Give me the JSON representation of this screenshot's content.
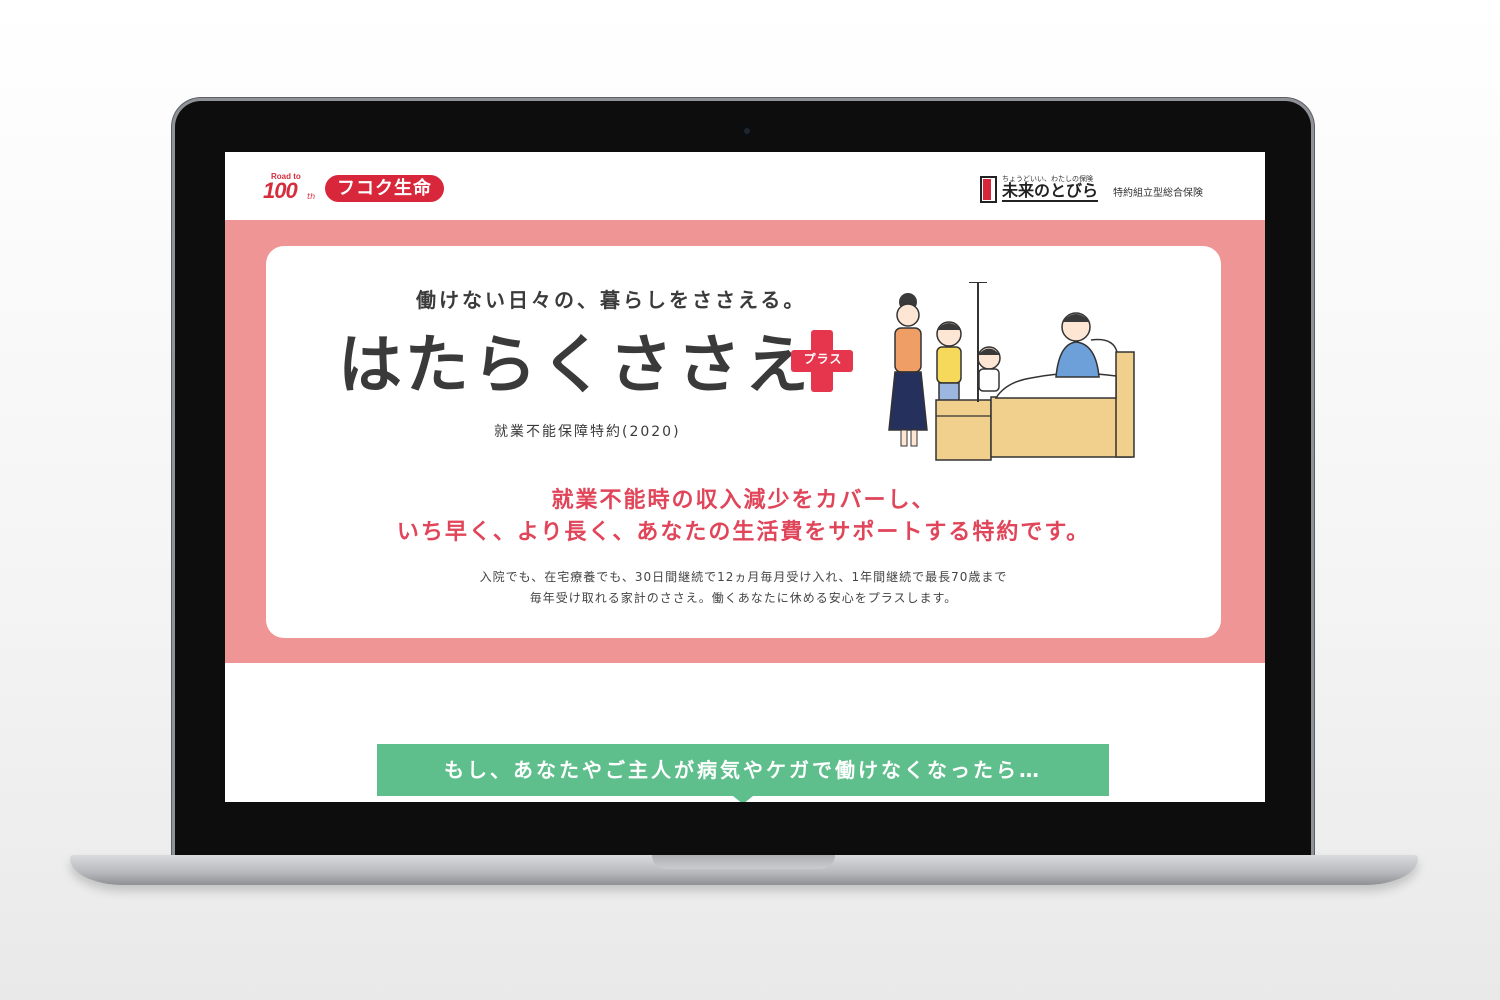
{
  "header": {
    "road_small": "Road to",
    "road_big": "100",
    "road_suffix": "th",
    "company": "フコク生命",
    "mirai_tagline": "ちょうどいい、わたしの保険",
    "mirai_name": "未来のとびら",
    "mirai_sub": "特約組立型総合保険"
  },
  "hero": {
    "tagline": "働けない日々の、暮らしをささえる。",
    "brand": "はたらくささえ",
    "plus_label": "プラス",
    "product_subtitle": "就業不能保障特約(2020)",
    "catch_line1": "就業不能時の収入減少をカバーし、",
    "catch_line2": "いち早く、より長く、あなたの生活費をサポートする特約です。",
    "desc_line1": "入院でも、在宅療養でも、30日間継続で12ヵ月毎月受け入れ、1年間継続で最長70歳まで",
    "desc_line2": "毎年受け取れる家計のささえ。働くあなたに休める安心をプラスします。"
  },
  "banner": {
    "text": "もし、あなたやご主人が病気やケガで働けなくなったら…"
  },
  "colors": {
    "hero_bg": "#ef9595",
    "brand_red": "#d8263b",
    "catch_pink": "#e0455a",
    "banner_green": "#5fbf8c"
  }
}
